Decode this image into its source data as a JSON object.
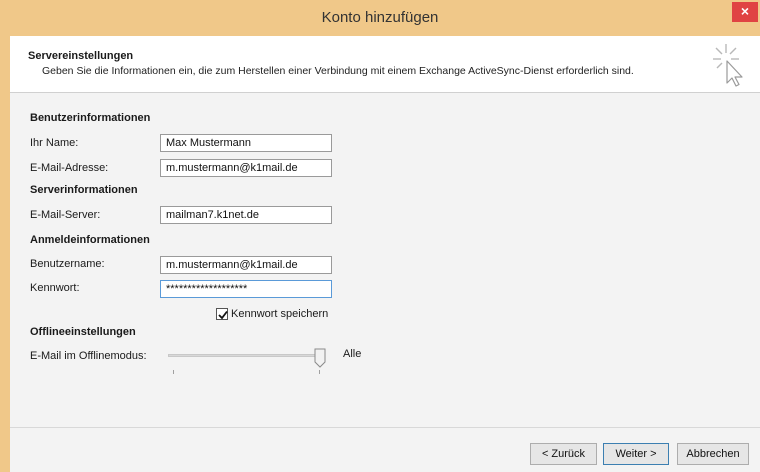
{
  "window": {
    "title": "Konto hinzufügen",
    "close_symbol": "×"
  },
  "header": {
    "title": "Servereinstellungen",
    "description": "Geben Sie die Informationen ein, die zum Herstellen einer Verbindung mit einem Exchange ActiveSync-Dienst erforderlich sind.",
    "icon": "cursor-sparkle-icon"
  },
  "sections": {
    "user_info": "Benutzerinformationen",
    "server_info": "Serverinformationen",
    "logon_info": "Anmeldeinformationen",
    "offline_settings": "Offlineeinstellungen"
  },
  "fields": {
    "name": {
      "label": "Ihr Name:",
      "value": "Max Mustermann"
    },
    "email": {
      "label": "E-Mail-Adresse:",
      "value": "m.mustermann@k1mail.de"
    },
    "server": {
      "label": "E-Mail-Server:",
      "value": "mailman7.k1net.de"
    },
    "username": {
      "label": "Benutzername:",
      "value": "m.mustermann@k1mail.de"
    },
    "password": {
      "label": "Kennwort:",
      "value": "*******************"
    }
  },
  "remember_password": {
    "label": "Kennwort speichern",
    "checked": true
  },
  "offline_mode": {
    "label": "E-Mail im Offlinemodus:",
    "value_label": "Alle",
    "level": 1.0
  },
  "buttons": {
    "back": "< Zurück",
    "next": "Weiter >",
    "cancel": "Abbrechen"
  },
  "colors": {
    "titlebar": "#f0c889",
    "close": "#e04343",
    "focus": "#5a9ad8"
  }
}
